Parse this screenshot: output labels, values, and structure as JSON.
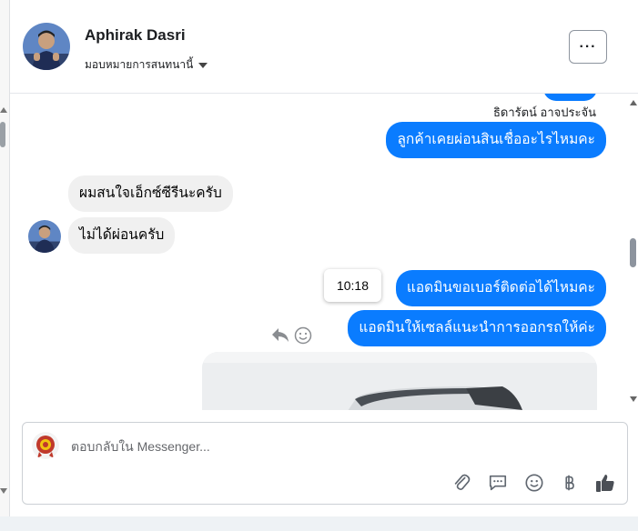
{
  "header": {
    "contact_name": "Aphirak Dasri",
    "assign_label": "มอบหมายการสนทนานี้",
    "more_label": "···"
  },
  "chat": {
    "sender_name": "ธิดารัตน์ อาจประจัน",
    "messages": [
      {
        "direction": "outgoing",
        "text": "ลูกค้าเคยผ่อนสินเชื่ออะไรไหมคะ"
      },
      {
        "direction": "incoming",
        "text": "ผมสนใจเอ็กซ์ซีรีนะครับ"
      },
      {
        "direction": "incoming",
        "text": "ไม่ได้ผ่อนครับ"
      },
      {
        "direction": "outgoing",
        "text": "แอดมินขอเบอร์ติดต่อได้ไหมคะ"
      },
      {
        "direction": "outgoing",
        "text": "แอดมินให้เซลล์แนะนำการออกรถให้ค่ะ"
      }
    ],
    "tooltip_time": "10:18"
  },
  "composer": {
    "placeholder": "ตอบกลับใน Messenger..."
  },
  "colors": {
    "outgoing_bubble": "#0a7cff",
    "incoming_bubble": "#f0f0f0"
  },
  "icons": [
    "paperclip-icon",
    "chat-bubble-icon",
    "emoji-icon",
    "baht-icon",
    "thumbs-up-icon",
    "reply-icon",
    "react-icon",
    "more-icon",
    "chevron-down-icon"
  ]
}
